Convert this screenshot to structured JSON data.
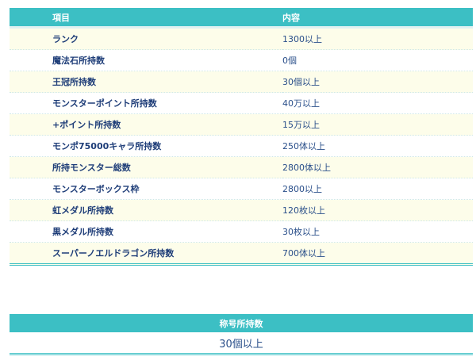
{
  "requirements_table": {
    "headers": {
      "item": "項目",
      "content": "内容"
    },
    "rows": [
      {
        "item": "ランク",
        "content": "1300以上"
      },
      {
        "item": "魔法石所持数",
        "content": "0個"
      },
      {
        "item": "王冠所持数",
        "content": "30個以上"
      },
      {
        "item": "モンスターポイント所持数",
        "content": "40万以上"
      },
      {
        "item": "+ポイント所持数",
        "content": "15万以上"
      },
      {
        "item": "モンポ75000キャラ所持数",
        "content": "250体以上"
      },
      {
        "item": "所持モンスター総数",
        "content": "2800体以上"
      },
      {
        "item": "モンスターボックス枠",
        "content": "2800以上"
      },
      {
        "item": "虹メダル所持数",
        "content": "120枚以上"
      },
      {
        "item": "黒メダル所持数",
        "content": "30枚以上"
      },
      {
        "item": "スーパーノエルドラゴン所持数",
        "content": "700体以上"
      }
    ]
  },
  "title_table": {
    "header": "称号所持数",
    "value": "30個以上"
  },
  "colors": {
    "header_bg": "#3cbfc4",
    "row_alt_bg": "#fdfdea",
    "text": "#1e3d78"
  }
}
